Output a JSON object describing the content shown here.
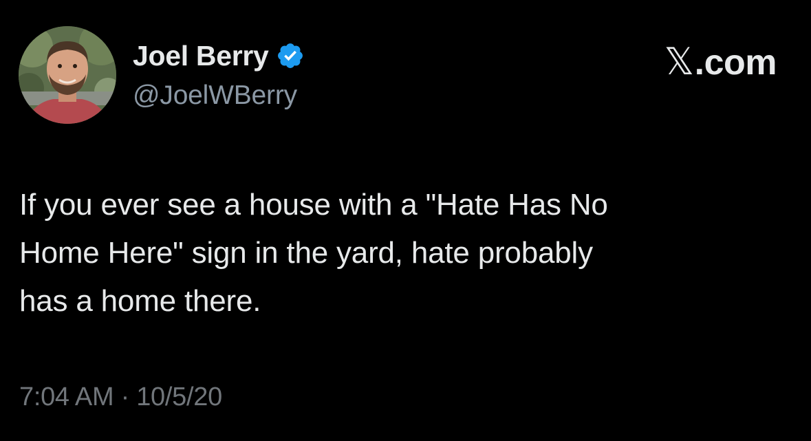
{
  "author": {
    "display_name": "Joel Berry",
    "handle": "@JoelWBerry",
    "verified": true,
    "avatar_icon": "person-photo-avatar",
    "verified_color": "#1d9bf0"
  },
  "brand": {
    "label": "X.com",
    "x_glyph": "𝕏",
    "rest": ".com"
  },
  "tweet": {
    "text": "If you ever see a house with a \"Hate Has No\nHome Here\" sign in the yard, hate probably\nhas a home there.",
    "time": "7:04 AM",
    "separator": "·",
    "date": "10/5/20"
  },
  "colors": {
    "background": "#000000",
    "primary_text": "#e7e9ea",
    "secondary_text": "#71767b",
    "handle_text": "#8b98a5"
  }
}
